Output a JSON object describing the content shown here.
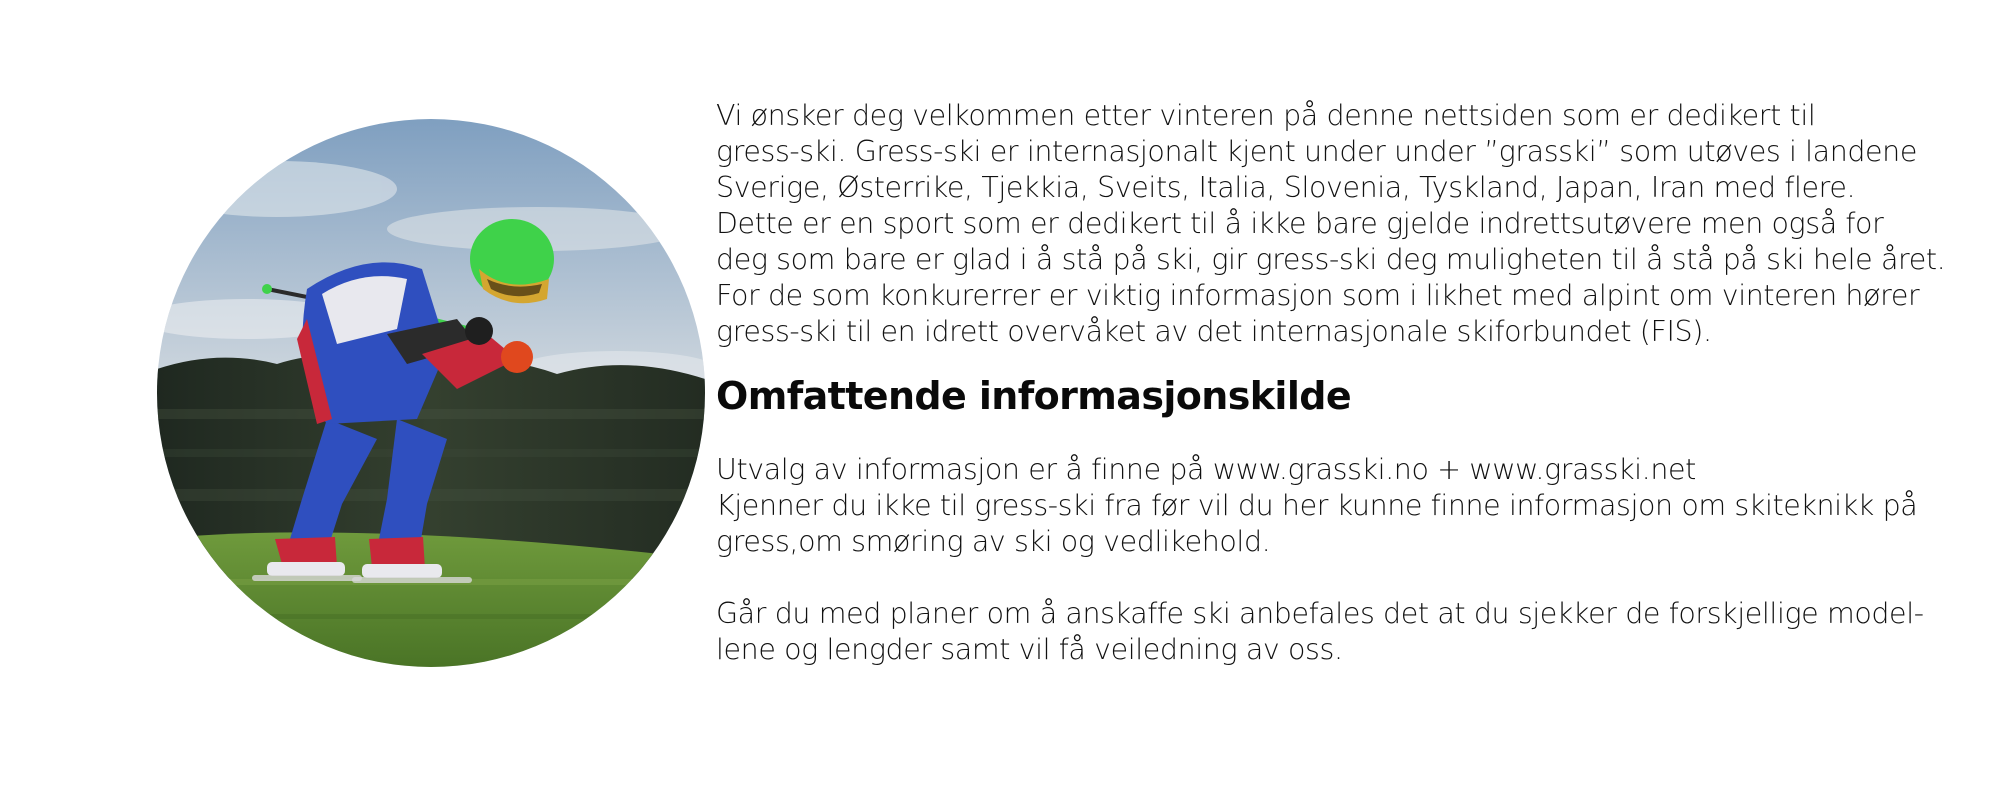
{
  "intro": {
    "lines": [
      "Vi ønsker deg velkommen etter vinteren på denne nettsiden som er dedikert til",
      "gress-ski. Gress-ski er internasjonalt kjent under under ”grasski” som utøves i landene",
      "Sverige, Østerrike, Tjekkia, Sveits, Italia, Slovenia, Tyskland, Japan, Iran med flere.",
      "Dette er en sport som er dedikert til å ikke bare gjelde indrettsutøvere men også for",
      "deg som bare er glad i å stå på ski, gir gress-ski deg muligheten til å stå på ski hele året.",
      "For de som konkurerrer  er viktig informasjon som i likhet med alpint om vinteren hører",
      "gress-ski til en idrett overvåket av det internasjonale skiforbundet (FIS)."
    ]
  },
  "section": {
    "heading": "Omfattende informasjonskilde",
    "paragraph1": [
      "Utvalg av informasjon er å finne på www.grasski.no + www.grasski.net",
      "Kjenner du ikke til gress-ski fra før vil du her kunne finne informasjon om skiteknikk på",
      "gress,om smøring av ski og vedlikehold."
    ],
    "paragraph2": [
      "Går du med planer om å anskaffe ski anbefales det at du sjekker de forskjellige model-",
      "lene og lengder samt vil få veiledning av oss."
    ]
  },
  "photo": {
    "colors": {
      "sky": "#a9bcd0",
      "trees": "#2a3328",
      "grass": "#5f8a34",
      "helmet": "#3fd24a",
      "suit_blue": "#2f4fbf",
      "suit_red": "#c8283a",
      "suit_white": "#e8e8ee"
    }
  }
}
